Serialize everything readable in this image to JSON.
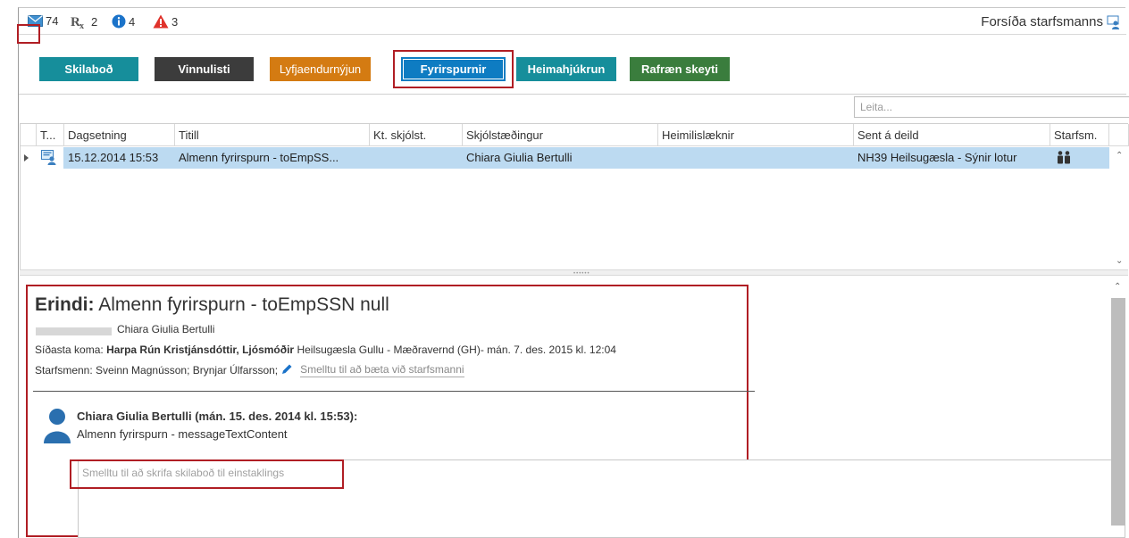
{
  "status_bar": {
    "messages_count": "74",
    "rx_count": "2",
    "info_count": "4",
    "alert_count": "3",
    "portal_label": "Forsíða starfsmanns"
  },
  "toolbar": {
    "tabs": [
      {
        "label": "Skilaboð",
        "color": "#168e9b"
      },
      {
        "label": "Vinnulisti",
        "color": "#3c3c3c"
      },
      {
        "label": "Lyfjaendurnýjun",
        "color": "#d47b12"
      },
      {
        "label": "Fyrirspurnir",
        "color": "#0e7cc2",
        "active": true
      },
      {
        "label": "Heimahjúkrun",
        "color": "#168e9b"
      },
      {
        "label": "Rafræn skeyti",
        "color": "#3a7d3d"
      }
    ]
  },
  "search": {
    "placeholder": "Leita..."
  },
  "grid": {
    "columns": [
      "T...",
      "Dagsetning",
      "Titill",
      "Kt. skjólst.",
      "Skjólstæðingur",
      "Heimilislæknir",
      "Sent á deild",
      "Starfsm."
    ],
    "rows": [
      {
        "type_icon": "message-chat-icon",
        "date": "15.12.2014 15:53",
        "title": "Almenn fyrirspurn - toEmpSS...",
        "kt": "",
        "patient": "Chiara Giulia Bertulli",
        "gp": "",
        "dept": "NH39 Heilsugæsla - Sýnir lotur",
        "staff_icon": "staff-people-icon"
      }
    ]
  },
  "detail": {
    "subject_label": "Erindi:",
    "subject": "Almenn fyrirspurn - toEmpSSN null",
    "patient": "Chiara Giulia Bertulli",
    "last_visit_label": "Síðasta koma:",
    "last_visit_person": "Harpa Rún Kristjánsdóttir, Ljósmóðir",
    "last_visit_rest": "Heilsugæsla Gullu - Mæðravernd (GH)- mán. 7. des. 2015 kl. 12:04",
    "staff_label": "Starfsmenn: Sveinn Magnússon;  Brynjar Úlfarsson;",
    "add_staff_label": "Smelltu til að bæta við starfsmanni",
    "message": {
      "author_time": "Chiara Giulia Bertulli (mán. 15. des. 2014 kl. 15:53):",
      "text": "Almenn fyrirspurn - messageTextContent"
    },
    "reply_placeholder": "Smelltu til að skrifa skilaboð til einstaklings"
  },
  "colors": {
    "highlight": "#b01e24",
    "selection": "#bcdaf1"
  }
}
